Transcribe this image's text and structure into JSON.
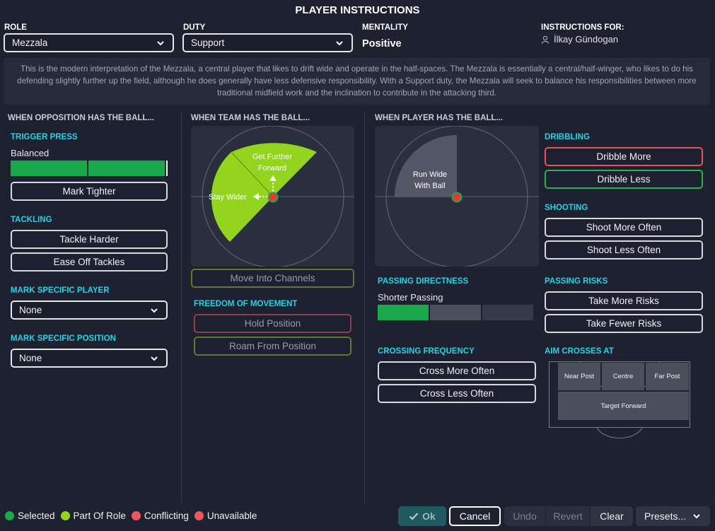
{
  "title": "PLAYER INSTRUCTIONS",
  "header": {
    "role_label": "ROLE",
    "role_value": "Mezzala",
    "duty_label": "DUTY",
    "duty_value": "Support",
    "mentality_label": "MENTALITY",
    "mentality_value": "Positive",
    "instructions_for_label": "INSTRUCTIONS FOR:",
    "player_name": "İlkay Gündogan"
  },
  "description": "This is the modern interpretation of the Mezzala, a central player that likes to drift wide and operate in the half-spaces. The Mezzala is essentially a central/half-winger, who likes to do his defending slightly further up the field, although he does generally have less defensive responsibility. With a Support duty, the Mezzala will seek to balance his responsibilities between more traditional midfield work and the inclination to contribute in the attacking third.",
  "opposition": {
    "heading": "WHEN OPPOSITION HAS THE BALL...",
    "trigger_press_label": "TRIGGER PRESS",
    "trigger_press_value": "Balanced",
    "trigger_press_level": 2,
    "mark_tighter": "Mark Tighter",
    "tackling_label": "TACKLING",
    "tackle_harder": "Tackle Harder",
    "ease_off_tackles": "Ease Off Tackles",
    "mark_player_label": "MARK SPECIFIC PLAYER",
    "mark_player_value": "None",
    "mark_position_label": "MARK SPECIFIC POSITION",
    "mark_position_value": "None"
  },
  "team": {
    "heading": "WHEN TEAM HAS THE BALL...",
    "get_further_forward": [
      "Get Further",
      "Forward"
    ],
    "stay_wider": "Stay Wider",
    "move_into_channels": "Move Into Channels",
    "freedom_label": "FREEDOM OF MOVEMENT",
    "hold_position": "Hold Position",
    "roam_from_position": "Roam From Position"
  },
  "player": {
    "heading": "WHEN PLAYER HAS THE BALL...",
    "run_wide": [
      "Run Wide",
      "With Ball"
    ],
    "passing_directness_label": "PASSING DIRECTNESS",
    "passing_directness_value": "Shorter Passing",
    "passing_directness_level": 1,
    "crossing_label": "CROSSING FREQUENCY",
    "cross_more": "Cross More Often",
    "cross_less": "Cross Less Often",
    "dribbling_label": "DRIBBLING",
    "dribble_more": "Dribble More",
    "dribble_less": "Dribble Less",
    "shooting_label": "SHOOTING",
    "shoot_more": "Shoot More Often",
    "shoot_less": "Shoot Less Often",
    "passing_risks_label": "PASSING RISKS",
    "more_risks": "Take More Risks",
    "fewer_risks": "Take Fewer Risks",
    "aim_crosses_label": "AIM CROSSES AT",
    "near_post": "Near Post",
    "centre": "Centre",
    "far_post": "Far Post",
    "target_forward": "Target Forward"
  },
  "legend": {
    "selected": "Selected",
    "part_of_role": "Part Of Role",
    "conflicting": "Conflicting",
    "unavailable": "Unavailable"
  },
  "footer": {
    "ok": "Ok",
    "cancel": "Cancel",
    "undo": "Undo",
    "revert": "Revert",
    "clear": "Clear",
    "presets": "Presets..."
  },
  "colors": {
    "selected": "#1aa84a",
    "part_of_role": "#93d51e",
    "conflicting": "#f0575c",
    "unavailable": "#f0575c",
    "accent_cyan": "#25d3e6"
  }
}
